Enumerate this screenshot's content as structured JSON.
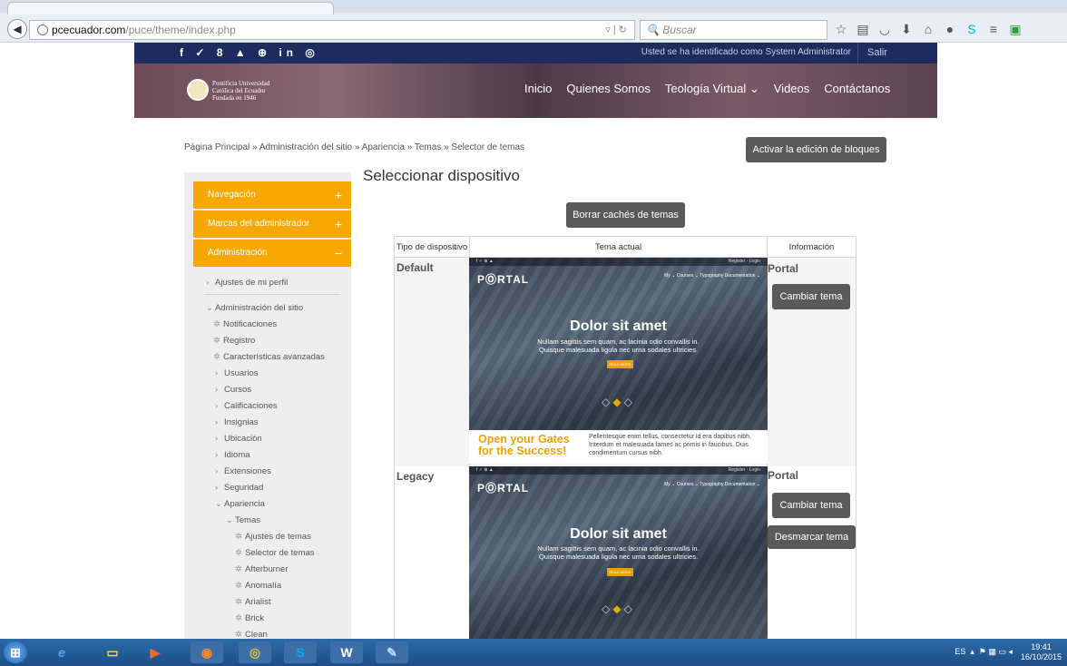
{
  "browser": {
    "url_host": "pcecuador.com",
    "url_path": "/puce/theme/index.php",
    "search_placeholder": "Buscar",
    "icons": [
      "star-icon",
      "reading-list-icon",
      "pocket-icon",
      "download-icon",
      "home-icon",
      "chat-icon",
      "skype-icon",
      "menu-icon",
      "extension-icon"
    ]
  },
  "topbar": {
    "social_icons": "f ✓ 8 ▲ ⊕ in ◎",
    "logged_in": "Usted se ha identificado como System Administrator",
    "logout": "Salir"
  },
  "header": {
    "logo_text": [
      "Pontificia Universidad",
      "Católica del Ecuador",
      "Fundada en 1946"
    ],
    "nav": {
      "inicio": "Inicio",
      "quienes": "Quienes Somos",
      "teologia": "Teología Virtual ⌄",
      "videos": "Videos",
      "contacto": "Contáctanos"
    }
  },
  "breadcrumb": "Página Principal » Administración del sitio » Apariencia » Temas » Selector de temas",
  "buttons": {
    "edit_blocks": "Activar la edición de bloques",
    "purge_caches": "Borrar cachés de temas",
    "change_theme": "Cambiar tema",
    "unset_theme": "Desmarcar tema"
  },
  "sidebar": {
    "blocks": [
      {
        "label": "Navegación",
        "sign": "+"
      },
      {
        "label": "Marcas del administrador",
        "sign": "+"
      },
      {
        "label": "Administración",
        "sign": "−"
      }
    ],
    "profile": "Ajustes de mi perfil",
    "site_admin": "Administración del sitio",
    "items": {
      "notificaciones": "Notificaciones",
      "registro": "Registro",
      "caracteristicas": "Características avanzadas",
      "usuarios": "Usuarios",
      "cursos": "Cursos",
      "calificaciones": "Calificaciones",
      "insignias": "Insignias",
      "ubicacion": "Ubicación",
      "idioma": "Idioma",
      "extensiones": "Extensiones",
      "seguridad": "Seguridad",
      "apariencia": "Apariencia",
      "temas": "Temas",
      "ajustes_temas": "Ajustes de temas",
      "selector_temas": "Selector de temas",
      "afterburner": "Afterburner",
      "anomalia": "Anomalía",
      "arialist": "Arialist",
      "brick": "Brick",
      "clean": "Clean"
    }
  },
  "main": {
    "title": "Seleccionar dispositivo",
    "table": {
      "headers": [
        "Tipo de dispositivo",
        "Tema actual",
        "Información"
      ],
      "rows": [
        {
          "device": "Default",
          "theme": "Portal"
        },
        {
          "device": "Legacy",
          "theme": "Portal"
        }
      ]
    },
    "preview": {
      "brand": "PⓄRTAL",
      "topline_left": "f ✓ ⊕ ▲",
      "topline_right": "Register · Login",
      "nav": "My ⌄   Courses ⌄   Typography   Documentation ⌄",
      "headline": "Dolor sit amet",
      "sub1": "Nullam sagittis sem quam, ac lacinia odio convallis in.",
      "sub2": "Quisque malesuada ligula nec urna sodales ultricies.",
      "readmore": "READ MORE",
      "gates_title_1": "Open your Gates",
      "gates_title_2": "for the Success!",
      "gates_text": "Pellentesque enim tellus, consectetur id era dapibus nibh. Interdum et malesuada fames ac primis in faucibus. Duis condimentum cursus nibh."
    }
  },
  "taskbar": {
    "lang": "ES",
    "time": "19:41",
    "date": "16/10/2015"
  }
}
